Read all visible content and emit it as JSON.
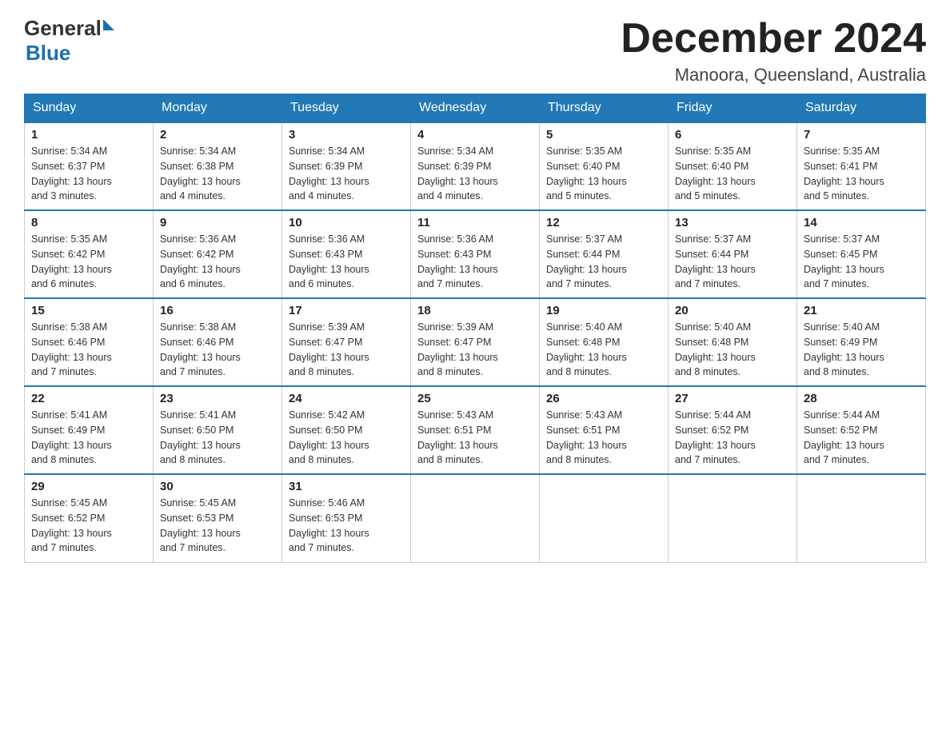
{
  "header": {
    "logo_general": "General",
    "logo_blue": "Blue",
    "month_title": "December 2024",
    "location": "Manoora, Queensland, Australia"
  },
  "weekdays": [
    "Sunday",
    "Monday",
    "Tuesday",
    "Wednesday",
    "Thursday",
    "Friday",
    "Saturday"
  ],
  "weeks": [
    [
      {
        "day": "1",
        "sunrise": "5:34 AM",
        "sunset": "6:37 PM",
        "daylight": "13 hours and 3 minutes."
      },
      {
        "day": "2",
        "sunrise": "5:34 AM",
        "sunset": "6:38 PM",
        "daylight": "13 hours and 4 minutes."
      },
      {
        "day": "3",
        "sunrise": "5:34 AM",
        "sunset": "6:39 PM",
        "daylight": "13 hours and 4 minutes."
      },
      {
        "day": "4",
        "sunrise": "5:34 AM",
        "sunset": "6:39 PM",
        "daylight": "13 hours and 4 minutes."
      },
      {
        "day": "5",
        "sunrise": "5:35 AM",
        "sunset": "6:40 PM",
        "daylight": "13 hours and 5 minutes."
      },
      {
        "day": "6",
        "sunrise": "5:35 AM",
        "sunset": "6:40 PM",
        "daylight": "13 hours and 5 minutes."
      },
      {
        "day": "7",
        "sunrise": "5:35 AM",
        "sunset": "6:41 PM",
        "daylight": "13 hours and 5 minutes."
      }
    ],
    [
      {
        "day": "8",
        "sunrise": "5:35 AM",
        "sunset": "6:42 PM",
        "daylight": "13 hours and 6 minutes."
      },
      {
        "day": "9",
        "sunrise": "5:36 AM",
        "sunset": "6:42 PM",
        "daylight": "13 hours and 6 minutes."
      },
      {
        "day": "10",
        "sunrise": "5:36 AM",
        "sunset": "6:43 PM",
        "daylight": "13 hours and 6 minutes."
      },
      {
        "day": "11",
        "sunrise": "5:36 AM",
        "sunset": "6:43 PM",
        "daylight": "13 hours and 7 minutes."
      },
      {
        "day": "12",
        "sunrise": "5:37 AM",
        "sunset": "6:44 PM",
        "daylight": "13 hours and 7 minutes."
      },
      {
        "day": "13",
        "sunrise": "5:37 AM",
        "sunset": "6:44 PM",
        "daylight": "13 hours and 7 minutes."
      },
      {
        "day": "14",
        "sunrise": "5:37 AM",
        "sunset": "6:45 PM",
        "daylight": "13 hours and 7 minutes."
      }
    ],
    [
      {
        "day": "15",
        "sunrise": "5:38 AM",
        "sunset": "6:46 PM",
        "daylight": "13 hours and 7 minutes."
      },
      {
        "day": "16",
        "sunrise": "5:38 AM",
        "sunset": "6:46 PM",
        "daylight": "13 hours and 7 minutes."
      },
      {
        "day": "17",
        "sunrise": "5:39 AM",
        "sunset": "6:47 PM",
        "daylight": "13 hours and 8 minutes."
      },
      {
        "day": "18",
        "sunrise": "5:39 AM",
        "sunset": "6:47 PM",
        "daylight": "13 hours and 8 minutes."
      },
      {
        "day": "19",
        "sunrise": "5:40 AM",
        "sunset": "6:48 PM",
        "daylight": "13 hours and 8 minutes."
      },
      {
        "day": "20",
        "sunrise": "5:40 AM",
        "sunset": "6:48 PM",
        "daylight": "13 hours and 8 minutes."
      },
      {
        "day": "21",
        "sunrise": "5:40 AM",
        "sunset": "6:49 PM",
        "daylight": "13 hours and 8 minutes."
      }
    ],
    [
      {
        "day": "22",
        "sunrise": "5:41 AM",
        "sunset": "6:49 PM",
        "daylight": "13 hours and 8 minutes."
      },
      {
        "day": "23",
        "sunrise": "5:41 AM",
        "sunset": "6:50 PM",
        "daylight": "13 hours and 8 minutes."
      },
      {
        "day": "24",
        "sunrise": "5:42 AM",
        "sunset": "6:50 PM",
        "daylight": "13 hours and 8 minutes."
      },
      {
        "day": "25",
        "sunrise": "5:43 AM",
        "sunset": "6:51 PM",
        "daylight": "13 hours and 8 minutes."
      },
      {
        "day": "26",
        "sunrise": "5:43 AM",
        "sunset": "6:51 PM",
        "daylight": "13 hours and 8 minutes."
      },
      {
        "day": "27",
        "sunrise": "5:44 AM",
        "sunset": "6:52 PM",
        "daylight": "13 hours and 7 minutes."
      },
      {
        "day": "28",
        "sunrise": "5:44 AM",
        "sunset": "6:52 PM",
        "daylight": "13 hours and 7 minutes."
      }
    ],
    [
      {
        "day": "29",
        "sunrise": "5:45 AM",
        "sunset": "6:52 PM",
        "daylight": "13 hours and 7 minutes."
      },
      {
        "day": "30",
        "sunrise": "5:45 AM",
        "sunset": "6:53 PM",
        "daylight": "13 hours and 7 minutes."
      },
      {
        "day": "31",
        "sunrise": "5:46 AM",
        "sunset": "6:53 PM",
        "daylight": "13 hours and 7 minutes."
      },
      null,
      null,
      null,
      null
    ]
  ],
  "labels": {
    "sunrise": "Sunrise:",
    "sunset": "Sunset:",
    "daylight": "Daylight:"
  }
}
